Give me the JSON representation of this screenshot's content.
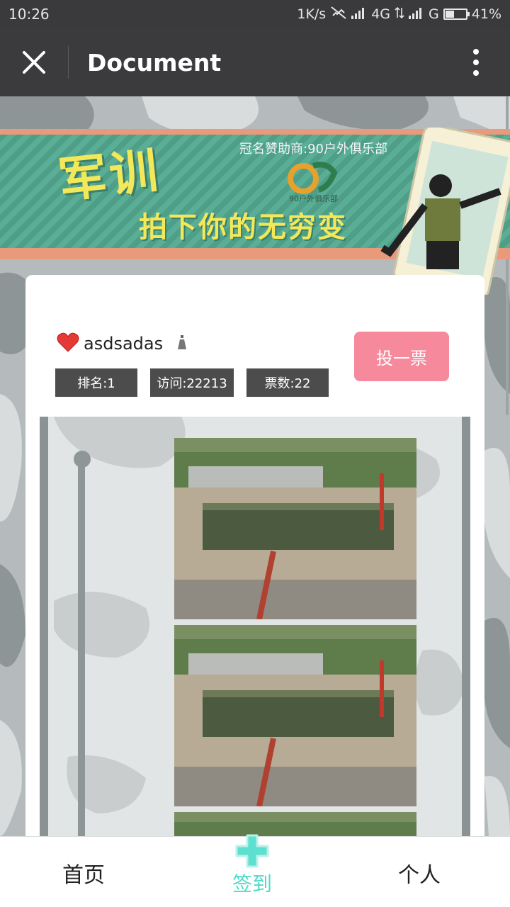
{
  "status_bar": {
    "time": "10:26",
    "speed": "1K/s",
    "network1": "4G",
    "network2": "G",
    "battery": "41%",
    "battery_level": 0.41
  },
  "header": {
    "title": "Document",
    "close_icon": "close-icon",
    "more_icon": "more-vertical-icon"
  },
  "banner": {
    "title": "军训",
    "subtitle": "拍下你的无穷变",
    "sponsor": "冠名赞助商:90户外俱乐部",
    "logo_text": "90户外俱乐部"
  },
  "profile": {
    "name": "asdsadas",
    "heart_icon": "heart-icon",
    "gender_icon": "person-icon",
    "stats": [
      {
        "label": "排名:1"
      },
      {
        "label": "访问:22213"
      },
      {
        "label": "票数:22"
      }
    ],
    "vote_label": "投一票"
  },
  "nav": {
    "home": "首页",
    "sign": "签到",
    "me": "个人"
  },
  "colors": {
    "accent": "#4fd9c8",
    "vote": "#f7899d",
    "header_bg": "#3b3b3d",
    "banner_green": "#4e9e88",
    "banner_yellow": "#f3e85a"
  }
}
